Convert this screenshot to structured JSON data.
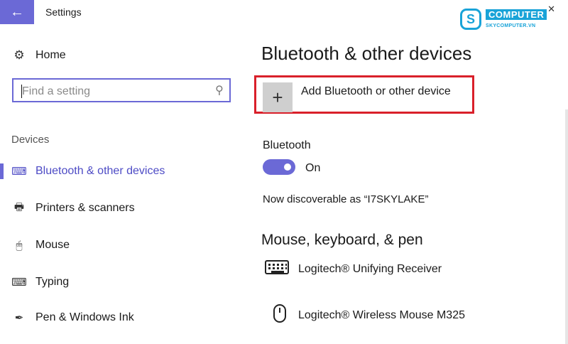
{
  "window": {
    "title": "Settings",
    "back_icon": "←",
    "close_icon": "✕"
  },
  "logo": {
    "mark": "S",
    "name": "COMPUTER",
    "site": "SKYCOMPUTER.VN",
    "color": "#19a3d8"
  },
  "sidebar": {
    "home": {
      "icon": "⚙",
      "label": "Home"
    },
    "search": {
      "placeholder": "Find a setting",
      "value": "",
      "icon": "⚲"
    },
    "section": "Devices",
    "items": [
      {
        "icon": "⌨",
        "label": "Bluetooth & other devices",
        "active": true
      },
      {
        "icon": "🖶",
        "label": "Printers & scanners",
        "active": false
      },
      {
        "icon": "🖱",
        "label": "Mouse",
        "active": false
      },
      {
        "icon": "⌨",
        "label": "Typing",
        "active": false
      },
      {
        "icon": "✒",
        "label": "Pen & Windows Ink",
        "active": false
      }
    ]
  },
  "main": {
    "title": "Bluetooth & other devices",
    "add_device": {
      "icon": "+",
      "label": "Add Bluetooth or other device"
    },
    "bluetooth": {
      "heading": "Bluetooth",
      "state": "On",
      "on": true
    },
    "discoverable": "Now discoverable as “I7SKYLAKE”",
    "peripherals_heading": "Mouse, keyboard, & pen",
    "devices": [
      {
        "icon": "keyboard-icon",
        "label": "Logitech® Unifying Receiver"
      },
      {
        "icon": "mouse-icon",
        "label": "Logitech® Wireless Mouse M325"
      }
    ]
  },
  "colors": {
    "accent": "#6b69d6",
    "highlight_box": "#d9202a"
  }
}
